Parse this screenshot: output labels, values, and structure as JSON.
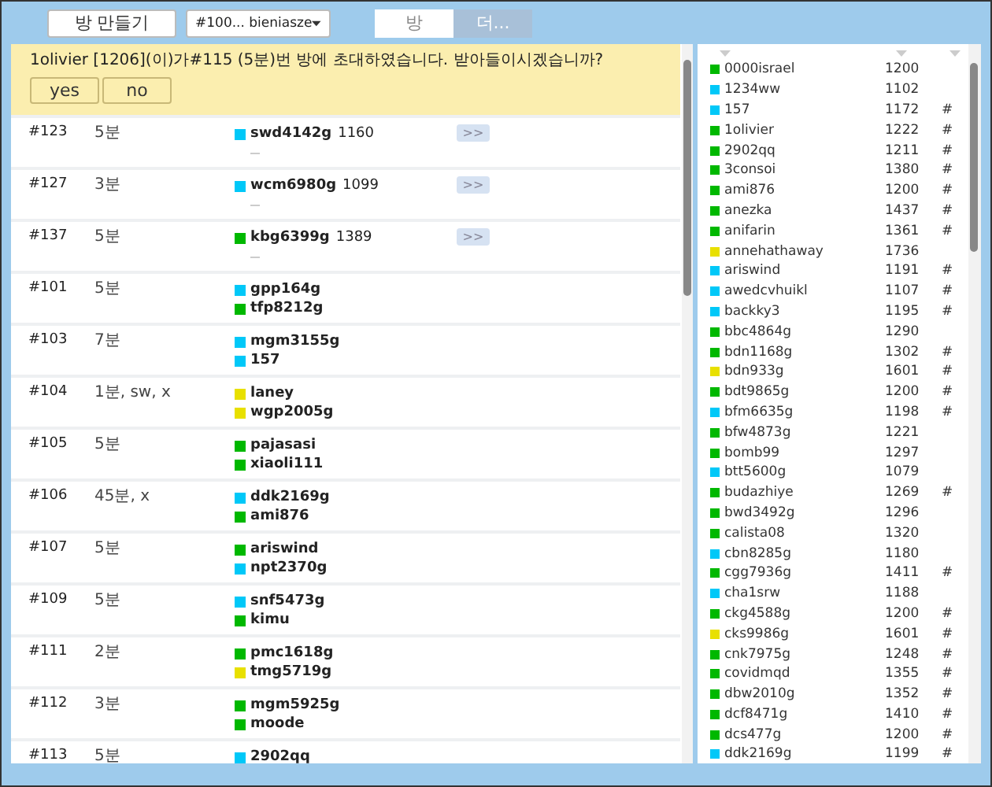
{
  "toolbar": {
    "create_button": "방 만들기",
    "room_select": "#100... bieniasze",
    "tabs": [
      {
        "label": "방",
        "selected": true
      },
      {
        "label": "더...",
        "selected": false
      }
    ]
  },
  "invitation": {
    "message": "1olivier [1206](이)가#115 (5분)번 방에 초대하였습니다. 받아들이시겠습니까?",
    "buttons": [
      "yes",
      "no"
    ]
  },
  "rooms": [
    {
      "id": "#123",
      "time": "5분",
      "players": [
        {
          "name": "swd4142g",
          "color": "#00c8f8",
          "rating": "1160"
        }
      ],
      "join_button": ">>"
    },
    {
      "id": "#127",
      "time": "3분",
      "players": [
        {
          "name": "wcm6980g",
          "color": "#00c8f8",
          "rating": "1099"
        }
      ],
      "join_button": ">>"
    },
    {
      "id": "#137",
      "time": "5분",
      "players": [
        {
          "name": "kbg6399g",
          "color": "#00b800",
          "rating": "1389"
        }
      ],
      "join_button": ">>"
    },
    {
      "id": "#101",
      "time": "5분",
      "players": [
        {
          "name": "gpp164g",
          "color": "#00c8f8"
        },
        {
          "name": "tfp8212g",
          "color": "#00b800"
        }
      ]
    },
    {
      "id": "#103",
      "time": "7분",
      "players": [
        {
          "name": "mgm3155g",
          "color": "#00c8f8"
        },
        {
          "name": "157",
          "color": "#00c8f8"
        }
      ]
    },
    {
      "id": "#104",
      "time": "1분, sw, x",
      "players": [
        {
          "name": "laney",
          "color": "#e8e000"
        },
        {
          "name": "wgp2005g",
          "color": "#e8e000"
        }
      ]
    },
    {
      "id": "#105",
      "time": "5분",
      "players": [
        {
          "name": "pajasasi",
          "color": "#00b800"
        },
        {
          "name": "xiaoli111",
          "color": "#00b800"
        }
      ]
    },
    {
      "id": "#106",
      "time": "45분, x",
      "players": [
        {
          "name": "ddk2169g",
          "color": "#00c8f8"
        },
        {
          "name": "ami876",
          "color": "#00b800"
        }
      ]
    },
    {
      "id": "#107",
      "time": "5분",
      "players": [
        {
          "name": "ariswind",
          "color": "#00b800"
        },
        {
          "name": "npt2370g",
          "color": "#00c8f8"
        }
      ]
    },
    {
      "id": "#109",
      "time": "5분",
      "players": [
        {
          "name": "snf5473g",
          "color": "#00c8f8"
        },
        {
          "name": "kimu",
          "color": "#00b800"
        }
      ]
    },
    {
      "id": "#111",
      "time": "2분",
      "players": [
        {
          "name": "pmc1618g",
          "color": "#00b800"
        },
        {
          "name": "tmg5719g",
          "color": "#e8e000"
        }
      ]
    },
    {
      "id": "#112",
      "time": "3분",
      "players": [
        {
          "name": "mgm5925g",
          "color": "#00b800"
        },
        {
          "name": "moode",
          "color": "#00b800"
        }
      ]
    },
    {
      "id": "#113",
      "time": "5분",
      "players": [
        {
          "name": "2902qq",
          "color": "#00c8f8"
        }
      ]
    }
  ],
  "users": [
    {
      "name": "0000israel",
      "color": "#00b800",
      "rating": "1200"
    },
    {
      "name": "1234ww",
      "color": "#00c8f8",
      "rating": "1102"
    },
    {
      "name": "157",
      "color": "#00c8f8",
      "rating": "1172",
      "mark": "#"
    },
    {
      "name": "1olivier",
      "color": "#00b800",
      "rating": "1222",
      "mark": "#"
    },
    {
      "name": "2902qq",
      "color": "#00b800",
      "rating": "1211",
      "mark": "#"
    },
    {
      "name": "3consoi",
      "color": "#00b800",
      "rating": "1380",
      "mark": "#"
    },
    {
      "name": "ami876",
      "color": "#00b800",
      "rating": "1200",
      "mark": "#"
    },
    {
      "name": "anezka",
      "color": "#00b800",
      "rating": "1437",
      "mark": "#"
    },
    {
      "name": "anifarin",
      "color": "#00b800",
      "rating": "1361",
      "mark": "#"
    },
    {
      "name": "annehathaway",
      "color": "#e8e000",
      "rating": "1736"
    },
    {
      "name": "ariswind",
      "color": "#00c8f8",
      "rating": "1191",
      "mark": "#"
    },
    {
      "name": "awedcvhuikl",
      "color": "#00c8f8",
      "rating": "1107",
      "mark": "#"
    },
    {
      "name": "backky3",
      "color": "#00c8f8",
      "rating": "1195",
      "mark": "#"
    },
    {
      "name": "bbc4864g",
      "color": "#00b800",
      "rating": "1290"
    },
    {
      "name": "bdn1168g",
      "color": "#00b800",
      "rating": "1302",
      "mark": "#"
    },
    {
      "name": "bdn933g",
      "color": "#e8e000",
      "rating": "1601",
      "mark": "#"
    },
    {
      "name": "bdt9865g",
      "color": "#00b800",
      "rating": "1200",
      "mark": "#"
    },
    {
      "name": "bfm6635g",
      "color": "#00c8f8",
      "rating": "1198",
      "mark": "#"
    },
    {
      "name": "bfw4873g",
      "color": "#00b800",
      "rating": "1221"
    },
    {
      "name": "bomb99",
      "color": "#00b800",
      "rating": "1297"
    },
    {
      "name": "btt5600g",
      "color": "#00c8f8",
      "rating": "1079"
    },
    {
      "name": "budazhiye",
      "color": "#00b800",
      "rating": "1269",
      "mark": "#"
    },
    {
      "name": "bwd3492g",
      "color": "#00b800",
      "rating": "1296"
    },
    {
      "name": "calista08",
      "color": "#00b800",
      "rating": "1320"
    },
    {
      "name": "cbn8285g",
      "color": "#00c8f8",
      "rating": "1180"
    },
    {
      "name": "cgg7936g",
      "color": "#00b800",
      "rating": "1411",
      "mark": "#"
    },
    {
      "name": "cha1srw",
      "color": "#00c8f8",
      "rating": "1188"
    },
    {
      "name": "ckg4588g",
      "color": "#00b800",
      "rating": "1200",
      "mark": "#"
    },
    {
      "name": "cks9986g",
      "color": "#e8e000",
      "rating": "1601",
      "mark": "#"
    },
    {
      "name": "cnk7975g",
      "color": "#00b800",
      "rating": "1248",
      "mark": "#"
    },
    {
      "name": "covidmqd",
      "color": "#00b800",
      "rating": "1355",
      "mark": "#"
    },
    {
      "name": "dbw2010g",
      "color": "#00b800",
      "rating": "1352",
      "mark": "#"
    },
    {
      "name": "dcf8471g",
      "color": "#00b800",
      "rating": "1410",
      "mark": "#"
    },
    {
      "name": "dcs477g",
      "color": "#00b800",
      "rating": "1200",
      "mark": "#"
    },
    {
      "name": "ddk2169g",
      "color": "#00c8f8",
      "rating": "1199",
      "mark": "#"
    }
  ]
}
